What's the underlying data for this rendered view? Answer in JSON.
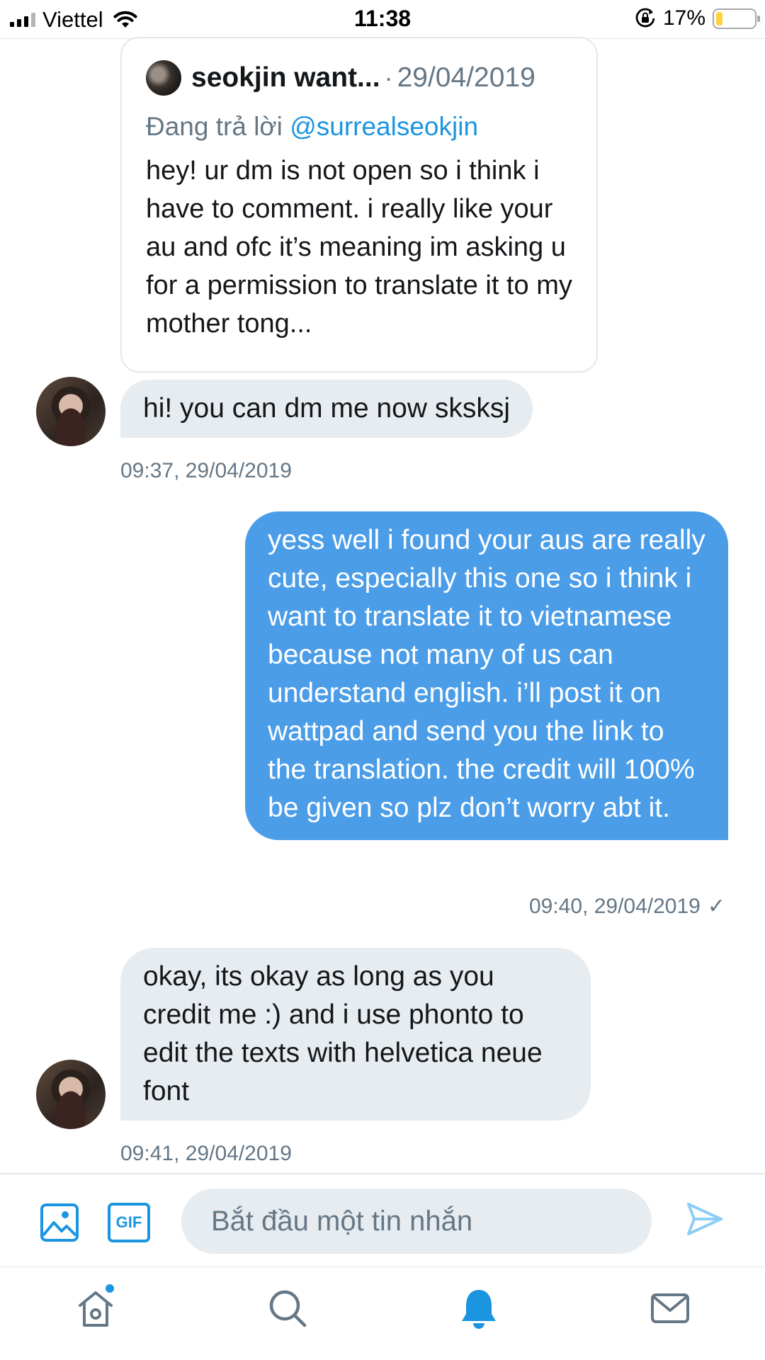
{
  "status_bar": {
    "carrier": "Viettel",
    "time": "11:38",
    "battery_percent_label": "17%",
    "battery_level": 0.17,
    "icons": [
      "signal-icon",
      "wifi-icon",
      "orientation-lock-icon",
      "battery-icon"
    ]
  },
  "quoted_tweet": {
    "author_name": "seokjin want...",
    "separator": "·",
    "date": "29/04/2019",
    "reply_prefix": "Đang trả lời",
    "reply_handle": "@surrealseokjin",
    "text": "hey! ur dm is not open so i think i have to comment. i really like your au and ofc it’s meaning im asking u for a permission to translate it to my mother tong..."
  },
  "messages": [
    {
      "direction": "in",
      "text": "hi! you can dm me now sksksj",
      "timestamp": "09:37, 29/04/2019"
    },
    {
      "direction": "out",
      "text": "yess well i found your aus are really cute, especially this one so i think i want to translate it to vietnamese because not many of us can understand english. i’ll post it on wattpad and send you the link to the translation. the credit will 100% be given so plz don’t worry abt it.",
      "timestamp": "09:40, 29/04/2019",
      "status_icon": "check-icon",
      "status_glyph": "✓"
    },
    {
      "direction": "in",
      "text": "okay, its okay as long as you credit me :) and i use phonto to edit the texts with helvetica neue font",
      "timestamp": "09:41, 29/04/2019"
    }
  ],
  "composer": {
    "media_icon": "image-icon",
    "gif_label": "GIF",
    "placeholder": "Bắt đầu một tin nhắn",
    "value": "",
    "send_icon": "send-icon"
  },
  "tab_bar": {
    "items": [
      {
        "name": "home",
        "icon": "home-icon",
        "has_badge": true
      },
      {
        "name": "search",
        "icon": "search-icon"
      },
      {
        "name": "notifications",
        "icon": "bell-icon",
        "active": true
      },
      {
        "name": "messages",
        "icon": "mail-icon"
      }
    ]
  },
  "colors": {
    "accent": "#1b95e0",
    "outgoing_bubble": "#4b9de8",
    "incoming_bubble": "#e6ecf0",
    "secondary_text": "#657786",
    "battery_fill": "#ffd23c"
  }
}
